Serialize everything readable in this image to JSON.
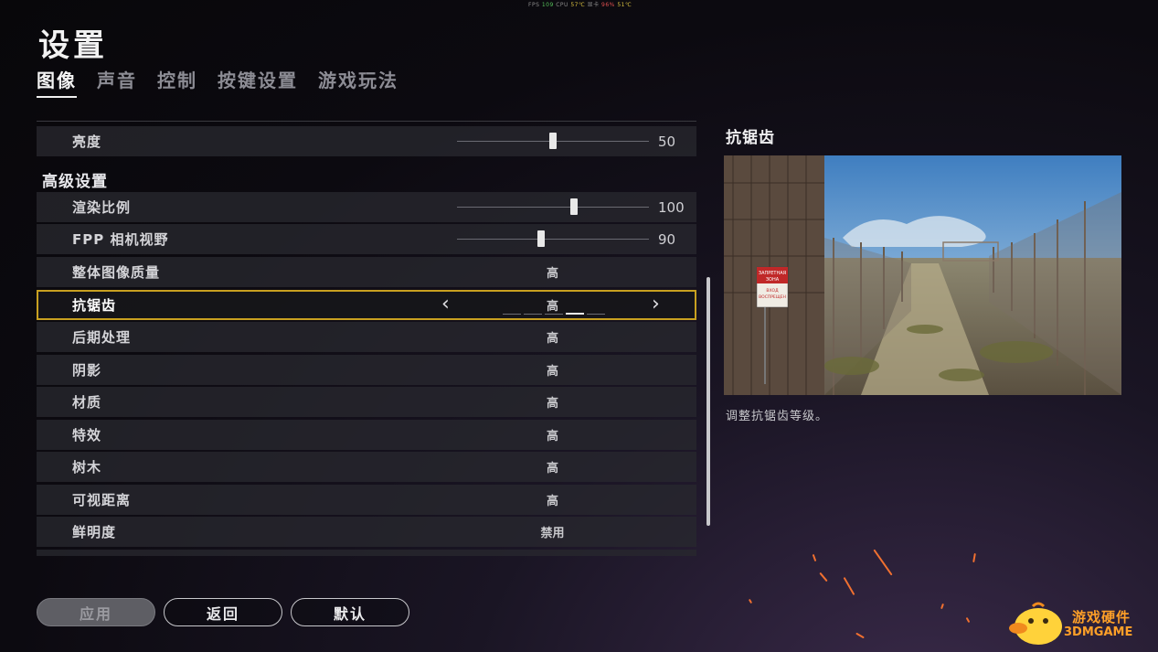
{
  "fps_overlay": {
    "fps_label": "FPS",
    "fps": "109",
    "cpu_label": "CPU",
    "cpu": "57℃",
    "gpu_label": "显卡",
    "gpu": "96%",
    "gpu_temp": "51℃"
  },
  "header": {
    "title": "设置"
  },
  "tabs": [
    {
      "label": "图像",
      "active": true
    },
    {
      "label": "声音",
      "active": false
    },
    {
      "label": "控制",
      "active": false
    },
    {
      "label": "按键设置",
      "active": false
    },
    {
      "label": "游戏玩法",
      "active": false
    }
  ],
  "settings": {
    "brightness": {
      "label": "亮度",
      "value": "50",
      "level": 0.5
    },
    "advanced_header": "高级设置",
    "render_scale": {
      "label": "渲染比例",
      "value": "100",
      "level": 0.61
    },
    "fpp_fov": {
      "label": "FPP 相机视野",
      "value": "90",
      "level": 0.44
    },
    "rows": [
      {
        "label": "整体图像质量",
        "value": "高"
      },
      {
        "label": "抗锯齿",
        "value": "高",
        "selected": true,
        "level_index": 3,
        "levels": 5
      },
      {
        "label": "后期处理",
        "value": "高"
      },
      {
        "label": "阴影",
        "value": "高"
      },
      {
        "label": "材质",
        "value": "高"
      },
      {
        "label": "特效",
        "value": "高"
      },
      {
        "label": "树木",
        "value": "高"
      },
      {
        "label": "可视距离",
        "value": "高"
      },
      {
        "label": "鲜明度",
        "value": "禁用"
      }
    ]
  },
  "description": {
    "title": "抗锯齿",
    "text": "调整抗锯齿等级。",
    "sign_line1": "ЗАПРЕТНАЯ",
    "sign_line2": "ЗОНА",
    "sign_line3": "ВХОД",
    "sign_line4": "ВОСПРЕЩЕН"
  },
  "buttons": {
    "apply": "应用",
    "back": "返回",
    "default": "默认"
  },
  "watermark": {
    "line1": "游戏硬件",
    "line2": "3DMGAME"
  },
  "colors": {
    "accent": "#c8a020",
    "logo": "#ffa028"
  }
}
